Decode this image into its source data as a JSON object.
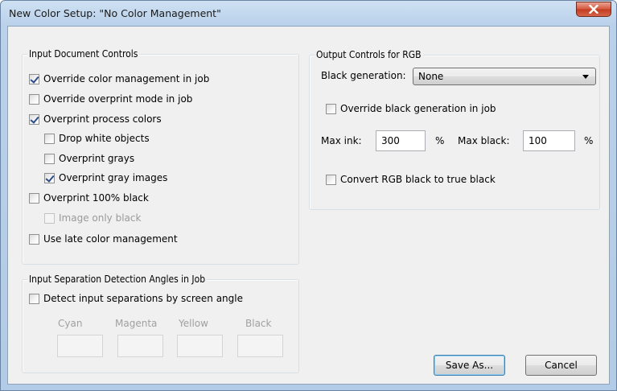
{
  "window": {
    "title": "New Color Setup: \"No Color Management\""
  },
  "input_document_controls": {
    "title": "Input Document Controls",
    "items": [
      {
        "label": "Override color management in job",
        "checked": true,
        "disabled": false
      },
      {
        "label": "Override overprint mode in job",
        "checked": false,
        "disabled": false
      },
      {
        "label": "Overprint process colors",
        "checked": true,
        "disabled": false
      },
      {
        "label": "Drop white objects",
        "checked": false,
        "disabled": false
      },
      {
        "label": "Overprint grays",
        "checked": false,
        "disabled": false
      },
      {
        "label": "Overprint gray images",
        "checked": true,
        "disabled": false
      },
      {
        "label": "Overprint 100% black",
        "checked": false,
        "disabled": false
      },
      {
        "label": "Image only black",
        "checked": false,
        "disabled": true
      },
      {
        "label": "Use late color management",
        "checked": false,
        "disabled": false
      }
    ]
  },
  "separation_detection": {
    "title": "Input Separation Detection Angles in Job",
    "detect_label": "Detect input separations by screen angle",
    "detect_checked": false,
    "channels": [
      {
        "label": "Cyan",
        "value": ""
      },
      {
        "label": "Magenta",
        "value": ""
      },
      {
        "label": "Yellow",
        "value": ""
      },
      {
        "label": "Black",
        "value": ""
      }
    ]
  },
  "output_controls": {
    "title": "Output Controls for RGB",
    "black_generation_label": "Black generation:",
    "black_generation_value": "None",
    "override_black_label": "Override black generation in job",
    "override_black_checked": false,
    "max_ink_label": "Max ink:",
    "max_ink_value": "300",
    "max_ink_unit": "%",
    "max_black_label": "Max black:",
    "max_black_value": "100",
    "max_black_unit": "%",
    "convert_label": "Convert RGB black to true black",
    "convert_checked": false
  },
  "buttons": {
    "save_as": "Save As...",
    "cancel": "Cancel"
  },
  "colors": {
    "titlebar": "#b9d1ea",
    "dialog_bg": "#f0f0f0",
    "close_button": "#c33b1f",
    "checkmark": "#2a4d8a"
  },
  "icons": {
    "close": "close-icon",
    "dropdown": "chevron-down-icon"
  }
}
